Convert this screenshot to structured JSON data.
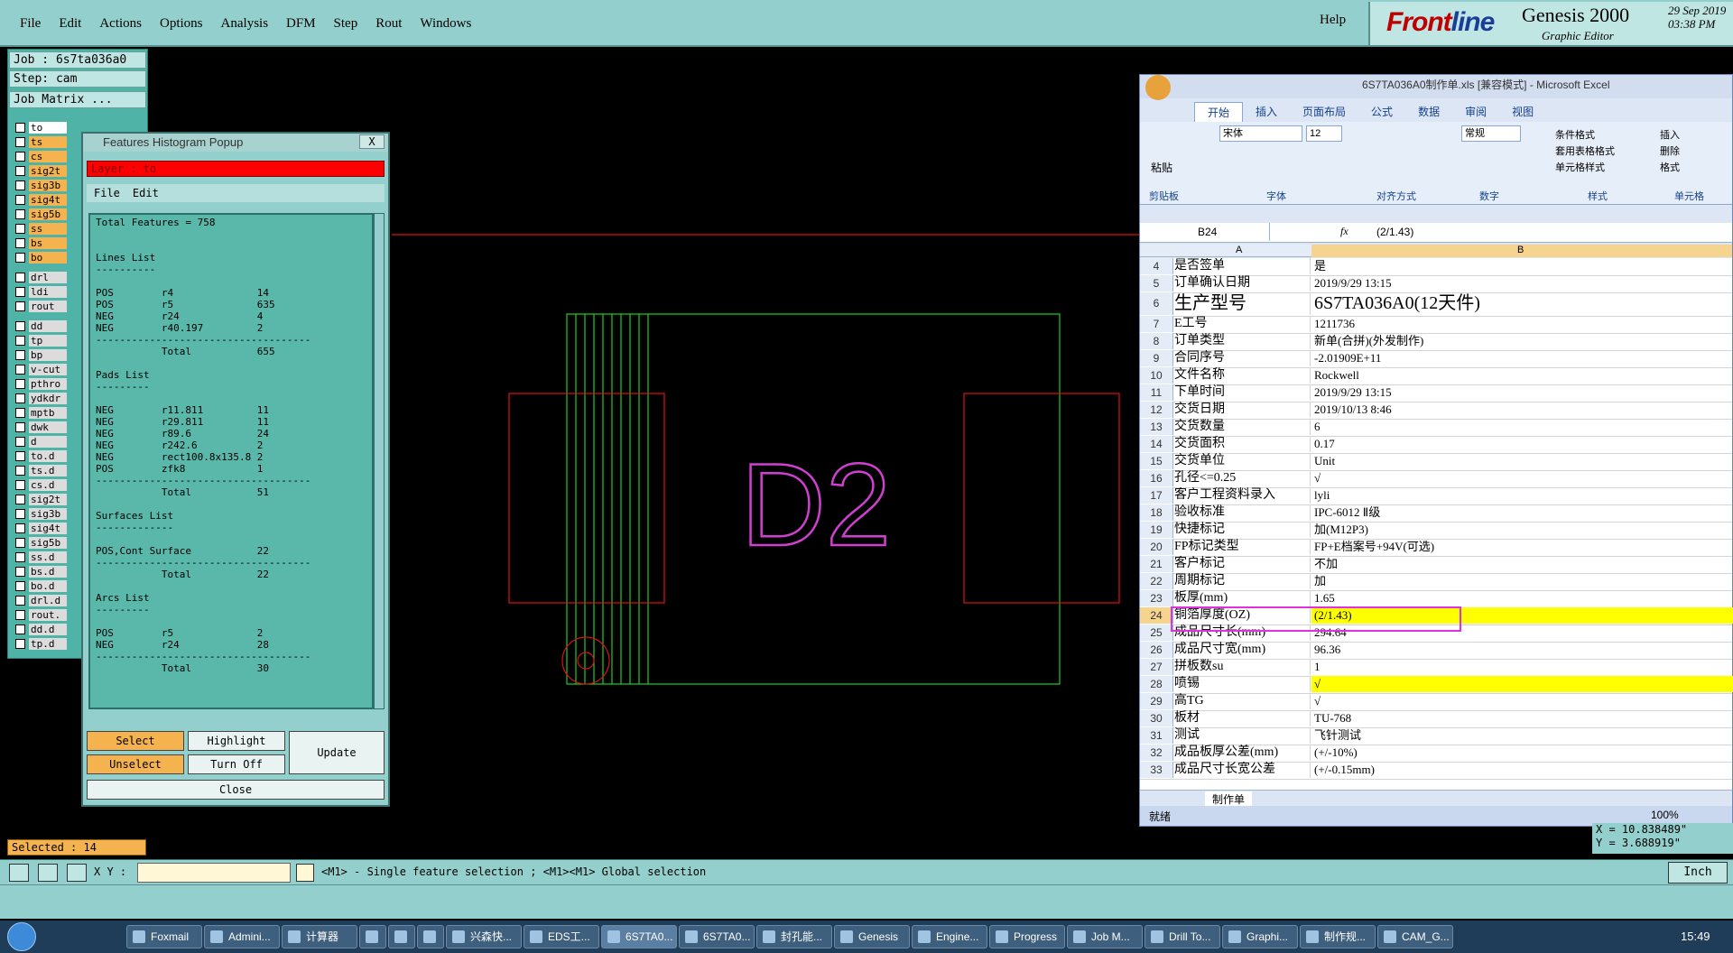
{
  "menu": [
    "File",
    "Edit",
    "Actions",
    "Options",
    "Analysis",
    "DFM",
    "Step",
    "Rout",
    "Windows"
  ],
  "help": "Help",
  "brand": {
    "logo_a": "Front",
    "logo_b": "line",
    "title": "Genesis 2000",
    "subtitle": "Graphic Editor",
    "date": "29 Sep 2019",
    "time": "03:38 PM"
  },
  "left": {
    "job": "Job : 6s7ta036a0",
    "step": "Step: cam",
    "job_matrix": "Job Matrix ...",
    "layers_a": [
      "to",
      "ts",
      "cs",
      "sig2t",
      "sig3b",
      "sig4t",
      "sig5b",
      "ss",
      "bs",
      "bo"
    ],
    "layers_b": [
      "drl",
      "ldi",
      "rout"
    ],
    "layers_c": [
      "dd",
      "tp",
      "bp",
      "v-cut",
      "pthro",
      "ydkdr",
      "mptb",
      "dwk",
      "d",
      "to.d",
      "ts.d",
      "cs.d",
      "sig2t",
      "sig3b",
      "sig4t",
      "sig5b",
      "ss.d",
      "bs.d",
      "bo.d",
      "drl.d",
      "rout.",
      "dd.d",
      "tp.d"
    ],
    "selected": "Selected : 14"
  },
  "popup": {
    "title": "Features Histogram Popup",
    "close_x": "X",
    "layer": "Layer :  to",
    "menu_file": "File",
    "menu_edit": "Edit",
    "body": "Total Features = 758\n\n\nLines List\n----------\n\nPOS        r4              14\nPOS        r5              635\nNEG        r24             4\nNEG        r40.197         2\n------------------------------------\n           Total           655\n\nPads List\n---------\n\nNEG        r11.811         11\nNEG        r29.811         11\nNEG        r89.6           24\nNEG        r242.6          2\nNEG        rect100.8x135.8 2\nPOS        zfk8            1\n------------------------------------\n           Total           51\n\nSurfaces List\n-------------\n\nPOS,Cont Surface           22\n------------------------------------\n           Total           22\n\nArcs List\n---------\n\nPOS        r5              2\nNEG        r24             28\n------------------------------------\n           Total           30",
    "select": "Select",
    "highlight": "Highlight",
    "update": "Update",
    "unselect": "Unselect",
    "turn_off": "Turn Off",
    "close": "Close"
  },
  "canvas": {
    "label": "D2"
  },
  "excel": {
    "title": "6S7TA036A0制作单.xls [兼容模式] - Microsoft Excel",
    "tabs": [
      "开始",
      "插入",
      "页面布局",
      "公式",
      "数据",
      "审阅",
      "视图"
    ],
    "font": "宋体",
    "font_size": "12",
    "number_format": "常规",
    "groups": [
      "剪贴板",
      "字体",
      "对齐方式",
      "数字",
      "样式",
      "单元格"
    ],
    "cmds": [
      "粘贴",
      "条件格式",
      "套用表格格式",
      "单元格样式",
      "插入",
      "删除",
      "格式"
    ],
    "name_box": "B24",
    "fx": "fx",
    "formula": "(2/1.43)",
    "col_a": "A",
    "col_b": "B",
    "rows": [
      {
        "n": "4",
        "a": "是否签单",
        "b": "是"
      },
      {
        "n": "5",
        "a": "订单确认日期",
        "b": "2019/9/29 13:15"
      },
      {
        "n": "6",
        "a": "生产型号",
        "b": "6S7TA036A0(12天件)"
      },
      {
        "n": "7",
        "a": "E工号",
        "b": "1211736"
      },
      {
        "n": "8",
        "a": "订单类型",
        "b": "新单(合拼)(外发制作)"
      },
      {
        "n": "9",
        "a": "合同序号",
        "b": "-2.01909E+11"
      },
      {
        "n": "10",
        "a": "文件名称",
        "b": "Rockwell"
      },
      {
        "n": "11",
        "a": "下单时间",
        "b": "2019/9/29 13:15"
      },
      {
        "n": "12",
        "a": "交货日期",
        "b": "2019/10/13 8:46"
      },
      {
        "n": "13",
        "a": "交货数量",
        "b": "6"
      },
      {
        "n": "14",
        "a": "交货面积",
        "b": "0.17"
      },
      {
        "n": "15",
        "a": "交货单位",
        "b": "Unit"
      },
      {
        "n": "16",
        "a": "孔径<=0.25",
        "b": "√"
      },
      {
        "n": "17",
        "a": "客户工程资料录入",
        "b": "lyli"
      },
      {
        "n": "18",
        "a": "验收标准",
        "b": "IPC-6012 Ⅱ级"
      },
      {
        "n": "19",
        "a": "快捷标记",
        "b": "加(M12P3)"
      },
      {
        "n": "20",
        "a": "FP标记类型",
        "b": "FP+E档案号+94V(可选)"
      },
      {
        "n": "21",
        "a": "客户标记",
        "b": "不加"
      },
      {
        "n": "22",
        "a": "周期标记",
        "b": "加"
      },
      {
        "n": "23",
        "a": "板厚(mm)",
        "b": "1.65"
      },
      {
        "n": "24",
        "a": "铜箔厚度(OZ)",
        "b": "(2/1.43)"
      },
      {
        "n": "25",
        "a": "成品尺寸长(mm)",
        "b": "294.64"
      },
      {
        "n": "26",
        "a": "成品尺寸宽(mm)",
        "b": "96.36"
      },
      {
        "n": "27",
        "a": "拼板数su",
        "b": "1"
      },
      {
        "n": "28",
        "a": "喷锡",
        "b": "√"
      },
      {
        "n": "29",
        "a": "高TG",
        "b": "√"
      },
      {
        "n": "30",
        "a": "板材",
        "b": "TU-768"
      },
      {
        "n": "31",
        "a": "测试",
        "b": "飞针测试"
      },
      {
        "n": "32",
        "a": "成品板厚公差(mm)",
        "b": "(+/-10%)"
      },
      {
        "n": "33",
        "a": "成品尺寸长宽公差",
        "b": "(+/-0.15mm)"
      }
    ],
    "sheet_tab": "制作单",
    "status": "就绪",
    "zoom": "100%",
    "highlight_color": "#ffff00"
  },
  "cmd": {
    "xy_label": "X Y :",
    "prompt": "<M1> - Single feature selection ; <M1><M1> Global selection",
    "unit": "Inch"
  },
  "coords": {
    "x": "X = 10.838489\"",
    "y": "Y = 3.688919\""
  },
  "taskbar": {
    "items": [
      "Foxmail",
      "Admini...",
      "计算器",
      "",
      "",
      "",
      "兴森快...",
      "EDS工...",
      "6S7TA0...",
      "6S7TA0...",
      "封孔能...",
      "Genesis",
      "Engine...",
      "Progress",
      "Job M...",
      "Drill To...",
      "Graphi...",
      "制作规...",
      "CAM_G..."
    ],
    "clock": "15:49"
  }
}
